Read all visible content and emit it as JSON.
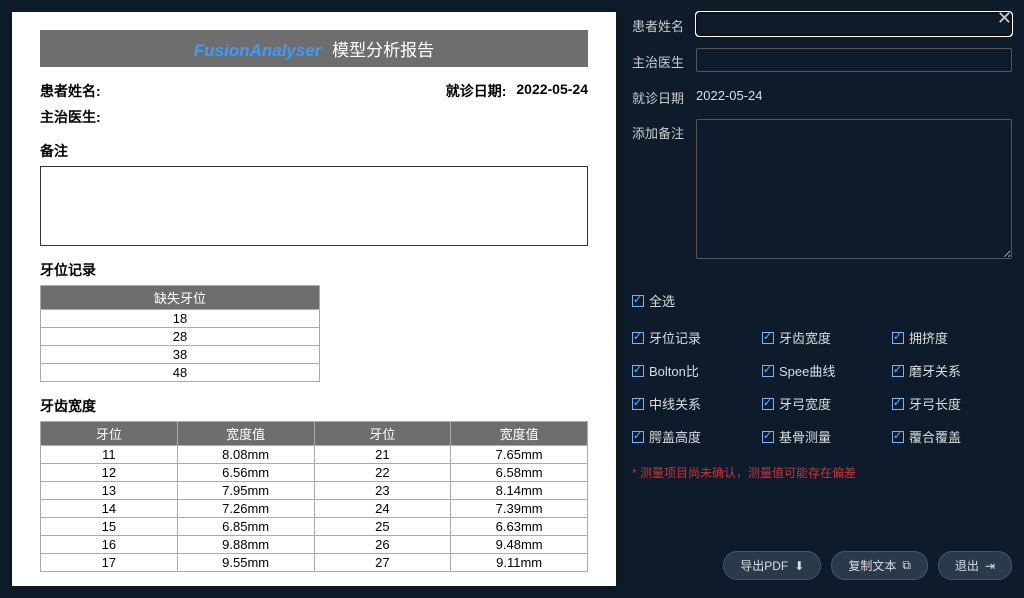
{
  "report": {
    "brand": "FusionAnalyser",
    "title_suffix": "模型分析报告",
    "meta": {
      "patient_label": "患者姓名:",
      "patient_value": "",
      "visit_label": "就诊日期:",
      "visit_value": "2022-05-24",
      "doctor_label": "主治医生:",
      "doctor_value": ""
    },
    "remark_label": "备注",
    "tooth_record_label": "牙位记录",
    "missing_header": "缺失牙位",
    "missing_rows": [
      "18",
      "28",
      "38",
      "48"
    ],
    "width_label": "牙齿宽度",
    "width_headers": [
      "牙位",
      "宽度值",
      "牙位",
      "宽度值"
    ],
    "width_rows": [
      [
        "11",
        "8.08mm",
        "21",
        "7.65mm"
      ],
      [
        "12",
        "6.56mm",
        "22",
        "6.58mm"
      ],
      [
        "13",
        "7.95mm",
        "23",
        "8.14mm"
      ],
      [
        "14",
        "7.26mm",
        "24",
        "7.39mm"
      ],
      [
        "15",
        "6.85mm",
        "25",
        "6.63mm"
      ],
      [
        "16",
        "9.88mm",
        "26",
        "9.48mm"
      ],
      [
        "17",
        "9.55mm",
        "27",
        "9.11mm"
      ]
    ]
  },
  "sidebar": {
    "patient_label": "患者姓名",
    "doctor_label": "主治医生",
    "visit_label": "就诊日期",
    "visit_value": "2022-05-24",
    "remark_label": "添加备注",
    "select_all": "全选",
    "checks": [
      "牙位记录",
      "牙齿宽度",
      "拥挤度",
      "Bolton比",
      "Spee曲线",
      "磨牙关系",
      "中线关系",
      "牙弓宽度",
      "牙弓长度",
      "腭盖高度",
      "基骨测量",
      "覆合覆盖"
    ],
    "warning": "* 测量项目尚未确认，测量值可能存在偏差",
    "btn_export": "导出PDF",
    "btn_copy": "复制文本",
    "btn_exit": "退出"
  }
}
